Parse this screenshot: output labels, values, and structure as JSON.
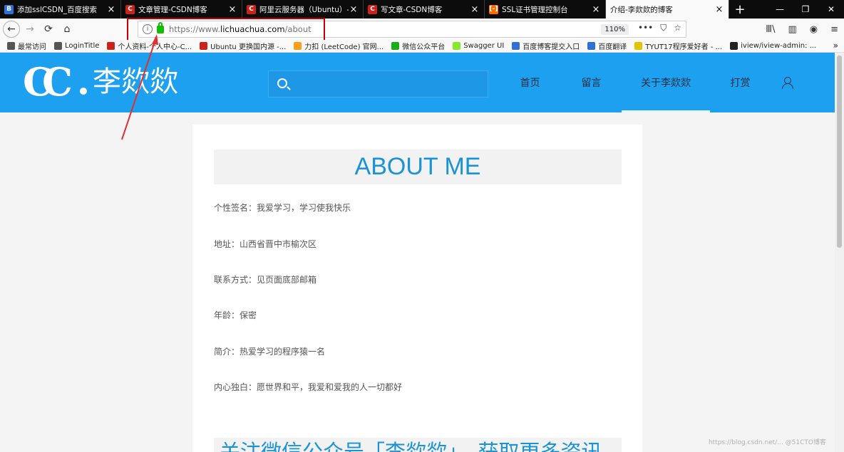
{
  "tabs": [
    {
      "title": "添加sslCSDN_百度搜索",
      "icon": "baidu",
      "active": false
    },
    {
      "title": "文章管理-CSDN博客",
      "icon": "csdn",
      "active": false
    },
    {
      "title": "阿里云服务器（Ubuntu）- ...",
      "icon": "csdn",
      "active": false
    },
    {
      "title": "写文章-CSDN博客",
      "icon": "csdn",
      "active": false
    },
    {
      "title": "SSL证书管理控制台",
      "icon": "ali",
      "active": false
    },
    {
      "title": "介绍-李欻欻的博客",
      "icon": "none",
      "active": true
    }
  ],
  "tab_close": "×",
  "newtab": "+",
  "window": {
    "minimize": "—",
    "restore": "❐",
    "close": "✕"
  },
  "nav": {
    "back": "←",
    "forward": "→",
    "reload": "⟳",
    "home": "⌂"
  },
  "urlbar": {
    "info": "i",
    "url_prefix": "https://www.",
    "url_domain": "lichuachua.com",
    "url_path": "/about",
    "zoom": "110%",
    "more": "•••",
    "pocket": "⛉",
    "bookmark": "☆"
  },
  "tools": {
    "library": "Ⅲ\\",
    "sidebar": "▥",
    "account": "◉",
    "menu": "≡"
  },
  "bookmarks": [
    {
      "label": "最常访问",
      "color": "#555555"
    },
    {
      "label": "LoginTitle",
      "color": "#555555"
    },
    {
      "label": "个人资料-个人中心-C...",
      "color": "#c9231b"
    },
    {
      "label": "Ubuntu 更换国内源 -...",
      "color": "#c9231b"
    },
    {
      "label": "力扣 (LeetCode) 官网...",
      "color": "#f89f1b"
    },
    {
      "label": "微信公众平台",
      "color": "#1aad19"
    },
    {
      "label": "Swagger UI",
      "color": "#85ea2d"
    },
    {
      "label": "百度博客提交入口",
      "color": "#2f6fd6"
    },
    {
      "label": "百度翻译",
      "color": "#2f6fd6"
    },
    {
      "label": "TYUT17程序爱好者 - ...",
      "color": "#e2c300"
    },
    {
      "label": "iview/iview-admin: ...",
      "color": "#222222"
    }
  ],
  "bookmarks_more": "»",
  "site": {
    "logo_mark": "CC",
    "logo_name": "李欻欻",
    "search_placeholder": "",
    "nav": [
      "首页",
      "留言",
      "关于李欻欻",
      "打赏"
    ],
    "active_nav": 2
  },
  "about": {
    "heading": "ABOUT ME",
    "fields": [
      "个性签名：我爱学习，学习使我快乐",
      "地址：山西省晋中市榆次区",
      "联系方式：见页面底部邮箱",
      "年龄：保密",
      "简介：热爱学习的程序猿一名",
      "内心独白：愿世界和平，我爱和爱我的人一切都好"
    ],
    "bottom_heading": "关注微信公众号「李欻欻」，获取更多资讯"
  },
  "watermark": "https://blog.csdn.net/... @51CTO博客"
}
